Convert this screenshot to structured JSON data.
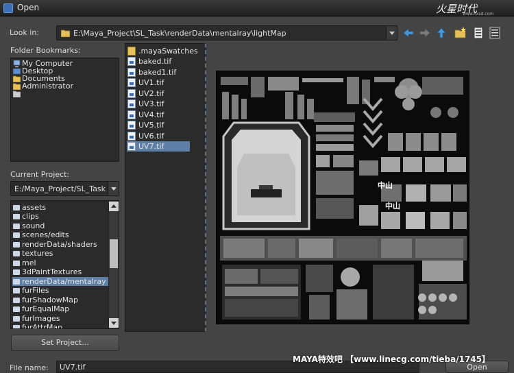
{
  "window": {
    "title": "Open"
  },
  "watermark": {
    "logo_text": "火星时代",
    "sub_text": "www.hxsd.com"
  },
  "look_in": {
    "label": "Look in:",
    "path": "E:\\Maya_Project\\SL_Task\\renderData\\mentalray\\lightMap"
  },
  "toolbar": {
    "icons": [
      "back-arrow-icon",
      "forward-arrow-icon",
      "up-folder-icon",
      "new-folder-icon",
      "list-view-icon",
      "detail-view-icon"
    ]
  },
  "bookmarks": {
    "label": "Folder Bookmarks:",
    "items": [
      {
        "label": "My Computer",
        "icon": "computer-icon"
      },
      {
        "label": "Desktop",
        "icon": "desktop-icon"
      },
      {
        "label": "Documents",
        "icon": "folder-icon"
      },
      {
        "label": "Administrator",
        "icon": "folder-icon"
      },
      {
        "label": "",
        "icon": "folder-icon"
      }
    ]
  },
  "project": {
    "label": "Current Project:",
    "value": "E:/Maya_Project/SL_Task",
    "folders": [
      "assets",
      "clips",
      "sound",
      "scenes/edits",
      "renderData/shaders",
      "textures",
      "mel",
      "3dPaintTextures",
      "renderData/mentalray",
      "furFiles",
      "furShadowMap",
      "furEqualMap",
      "furImages",
      "furAttrMap"
    ],
    "selected_folder": "renderData/mentalray",
    "set_project_label": "Set Project..."
  },
  "files": {
    "items": [
      {
        "label": ".mayaSwatches",
        "type": "folder"
      },
      {
        "label": "baked.tif",
        "type": "tif"
      },
      {
        "label": "baked1.tif",
        "type": "tif"
      },
      {
        "label": "UV1.tif",
        "type": "tif"
      },
      {
        "label": "UV2.tif",
        "type": "tif"
      },
      {
        "label": "UV3.tif",
        "type": "tif"
      },
      {
        "label": "UV4.tif",
        "type": "tif"
      },
      {
        "label": "UV5.tif",
        "type": "tif"
      },
      {
        "label": "UV6.tif",
        "type": "tif"
      },
      {
        "label": "UV7.tif",
        "type": "tif"
      }
    ],
    "selected": "UV7.tif"
  },
  "preview": {
    "image_name": "UV7.tif",
    "labels": [
      "中山",
      "中山"
    ]
  },
  "footer": {
    "file_name_label": "File name:",
    "file_name_value": "UV7.tif",
    "open_label": "Open",
    "banner": "MAYA特效吧 【www.linecg.com/tieba/1745】"
  }
}
